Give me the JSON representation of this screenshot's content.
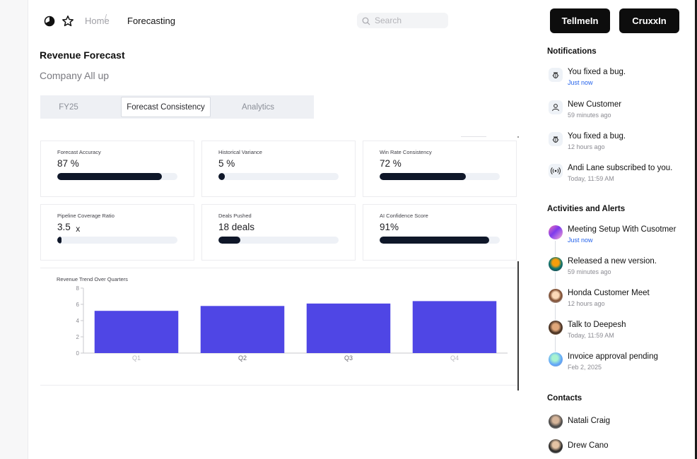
{
  "header": {
    "breadcrumb_home": "Home",
    "breadcrumb_separator": "/",
    "breadcrumb_current": "Forecasting",
    "search_placeholder": "Search",
    "buttons": [
      "TellmeIn",
      "CruxxIn"
    ]
  },
  "page": {
    "title": "Revenue Forecast",
    "subtitle": "Company All up",
    "tabs": [
      "FY25",
      "Forecast Consistency",
      "Analytics"
    ],
    "active_tab": "Forecast Consistency"
  },
  "metrics": [
    {
      "label": "Forecast Accuracy",
      "value": "87 %",
      "progress": 0.87
    },
    {
      "label": "Historical Variance",
      "value": "5 %",
      "progress": 0.05
    },
    {
      "label": "Win Rate Consistency",
      "value": "72 %",
      "progress": 0.72
    },
    {
      "label": "Pipeline Coverage Ratio",
      "value": "3.5",
      "suffix": "x",
      "progress": 0.035
    },
    {
      "label": "Deals Pushed",
      "value": "18 deals",
      "progress": 0.18
    },
    {
      "label": "AI Confidence Score",
      "value": "91%",
      "progress": 0.91
    }
  ],
  "chart_data": {
    "type": "bar",
    "title": "Revenue Trend Over Quarters",
    "categories": [
      "Q1",
      "Q2",
      "Q3",
      "Q4"
    ],
    "values": [
      5.2,
      5.8,
      6.1,
      6.4
    ],
    "yticks": [
      "0",
      "2",
      "4",
      "6",
      "8"
    ],
    "ylim": [
      0,
      8
    ],
    "bar_color": "#4f46e5",
    "grid": false,
    "legend": "none"
  },
  "notifications": {
    "title": "Notifications",
    "items": [
      {
        "icon": "bug-icon",
        "text": "You fixed a bug.",
        "time": "Just now",
        "highlight": true
      },
      {
        "icon": "user-icon",
        "text": "New Customer",
        "time": "59 minutes ago",
        "highlight": false
      },
      {
        "icon": "bug-icon",
        "text": "You fixed a bug.",
        "time": "12 hours ago",
        "highlight": false
      },
      {
        "icon": "broadcast-icon",
        "text": "Andi Lane subscribed to you.",
        "time": "Today, 11:59 AM",
        "highlight": false
      }
    ]
  },
  "activities": {
    "title": "Activities and Alerts",
    "items": [
      {
        "text": "Meeting Setup With Cusotmer",
        "time": "Just now",
        "highlight": true
      },
      {
        "text": "Released a new version.",
        "time": "59 minutes ago",
        "highlight": false
      },
      {
        "text": "Honda Customer Meet",
        "time": "12 hours ago",
        "highlight": false
      },
      {
        "text": "Talk to Deepesh",
        "time": "Today, 11:59 AM",
        "highlight": false
      },
      {
        "text": "Invoice approval pending",
        "time": "Feb 2, 2025",
        "highlight": false
      }
    ]
  },
  "contacts": {
    "title": "Contacts",
    "items": [
      "Natali Craig",
      "Drew Cano"
    ]
  },
  "colors": {
    "accent_blue": "#2563eb",
    "progress_fill": "#0f1729",
    "bar": "#4f46e5"
  }
}
